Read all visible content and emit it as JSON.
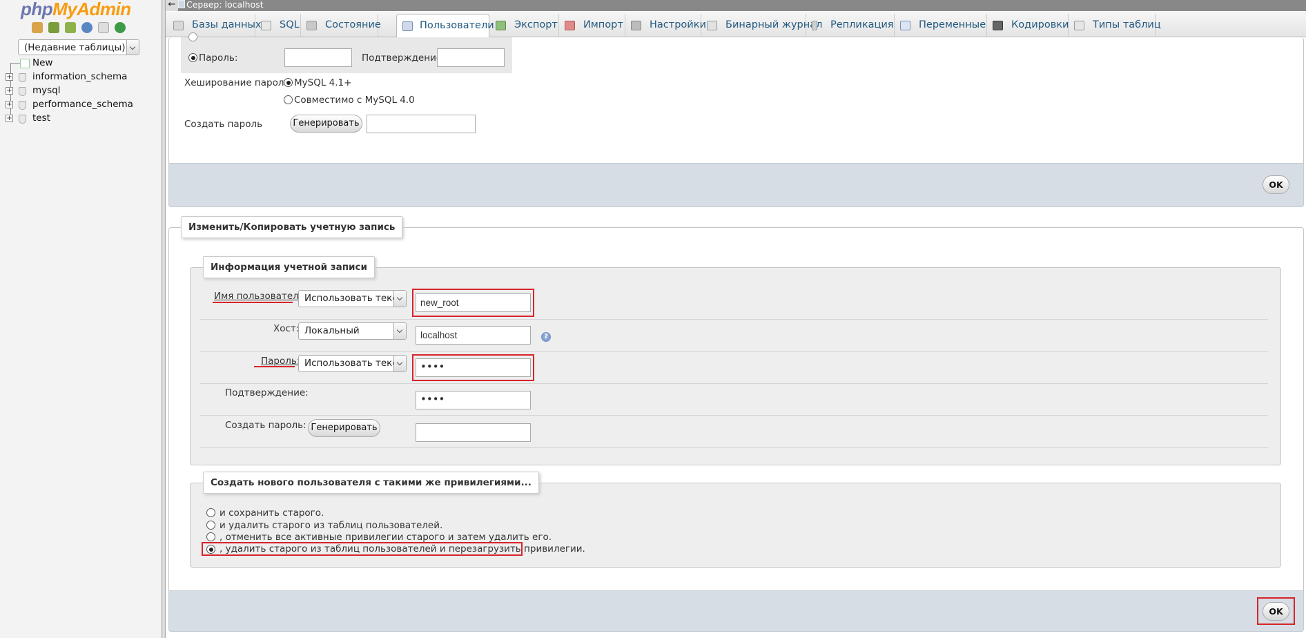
{
  "nav": {
    "logo_part1": "php",
    "logo_part2": "MyAdmin",
    "recent_tables": "(Недавние таблицы) ...",
    "tree": [
      "New",
      "information_schema",
      "mysql",
      "performance_schema",
      "test"
    ]
  },
  "topbar": {
    "back_glyph": "←",
    "title": "Сервер: localhost"
  },
  "tabs": [
    {
      "label": "Базы данных",
      "icon": "databases-icon"
    },
    {
      "label": "SQL",
      "icon": "sql-icon"
    },
    {
      "label": "Состояние",
      "icon": "status-icon"
    },
    {
      "label": "Пользователи",
      "icon": "users-icon",
      "active": true
    },
    {
      "label": "Экспорт",
      "icon": "export-icon"
    },
    {
      "label": "Импорт",
      "icon": "import-icon"
    },
    {
      "label": "Настройки",
      "icon": "settings-icon"
    },
    {
      "label": "Бинарный журнал",
      "icon": "binlog-icon"
    },
    {
      "label": "Репликация",
      "icon": "replication-icon"
    },
    {
      "label": "Переменные",
      "icon": "variables-icon"
    },
    {
      "label": "Кодировки",
      "icon": "charset-icon"
    },
    {
      "label": "Типы таблиц",
      "icon": "engines-icon"
    }
  ],
  "password_section": {
    "password_label": "Пароль:",
    "confirm_label": "Подтверждение:",
    "hashing_label": "Хеширование пароля:",
    "hash_option1": "MySQL 4.1+",
    "hash_option2": "Совместимо с MySQL 4.0",
    "generate_label": "Создать пароль",
    "generate_button": "Генерировать",
    "ok_button": "OK"
  },
  "edit_copy": {
    "legend": "Изменить/Копировать учетную запись",
    "account_info": {
      "legend": "Информация учетной записи",
      "username_label": "Имя пользователя:",
      "username_select": "Использовать текстовое поле",
      "username_value": "new_root",
      "host_label": "Хост:",
      "host_select": "Локальный",
      "host_value": "localhost",
      "password_label": "Пароль:",
      "password_select": "Использовать текстовое поле",
      "password_value": "••••",
      "confirm_label": "Подтверждение:",
      "confirm_value": "••••",
      "generate_label": "Создать пароль:",
      "generate_button": "Генерировать"
    },
    "new_user": {
      "legend": "Создать нового пользователя с такими же привилегиями...",
      "options": [
        "и сохранить старого.",
        "и удалить старого из таблиц пользователей.",
        ", отменить все активные привилегии старого и затем удалить его.",
        ", удалить старого из таблиц пользователей и перезагрузить привилегии."
      ],
      "selected_index": 3
    },
    "ok_button": "OK"
  },
  "colors": {
    "highlight": "#d8232a",
    "tab_text": "#235a81",
    "footer": "#d6dde4"
  }
}
